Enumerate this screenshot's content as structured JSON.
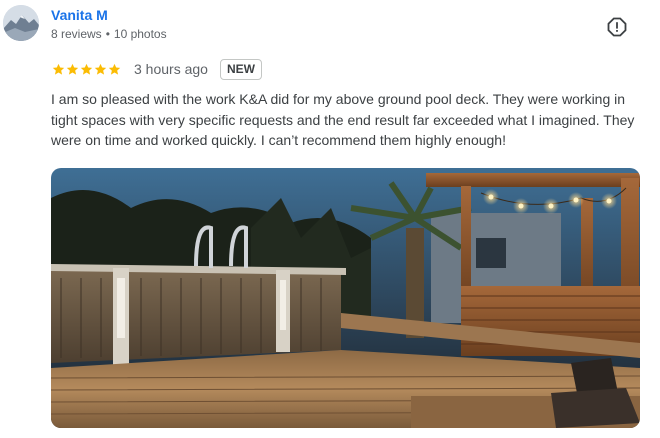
{
  "reviewer": {
    "name": "Vanita M",
    "reviews": "8 reviews",
    "separator": "•",
    "photos": "10 photos"
  },
  "rating": {
    "stars": 5,
    "time_ago": "3 hours ago",
    "badge": "NEW"
  },
  "review": {
    "text": "I am so pleased with the work K&A did for my above ground pool deck. They were working in tight spaces with very specific requests and the end result far exceeded what I imagined. They were on time and worked quickly. I can’t recommend them highly enough!"
  },
  "icons": {
    "report": "report-flag-icon",
    "star": "star-icon"
  },
  "colors": {
    "name_link": "#1a73e8",
    "star": "#fbbc04",
    "meta_text": "#5f6368",
    "body_text": "#3c4043"
  }
}
